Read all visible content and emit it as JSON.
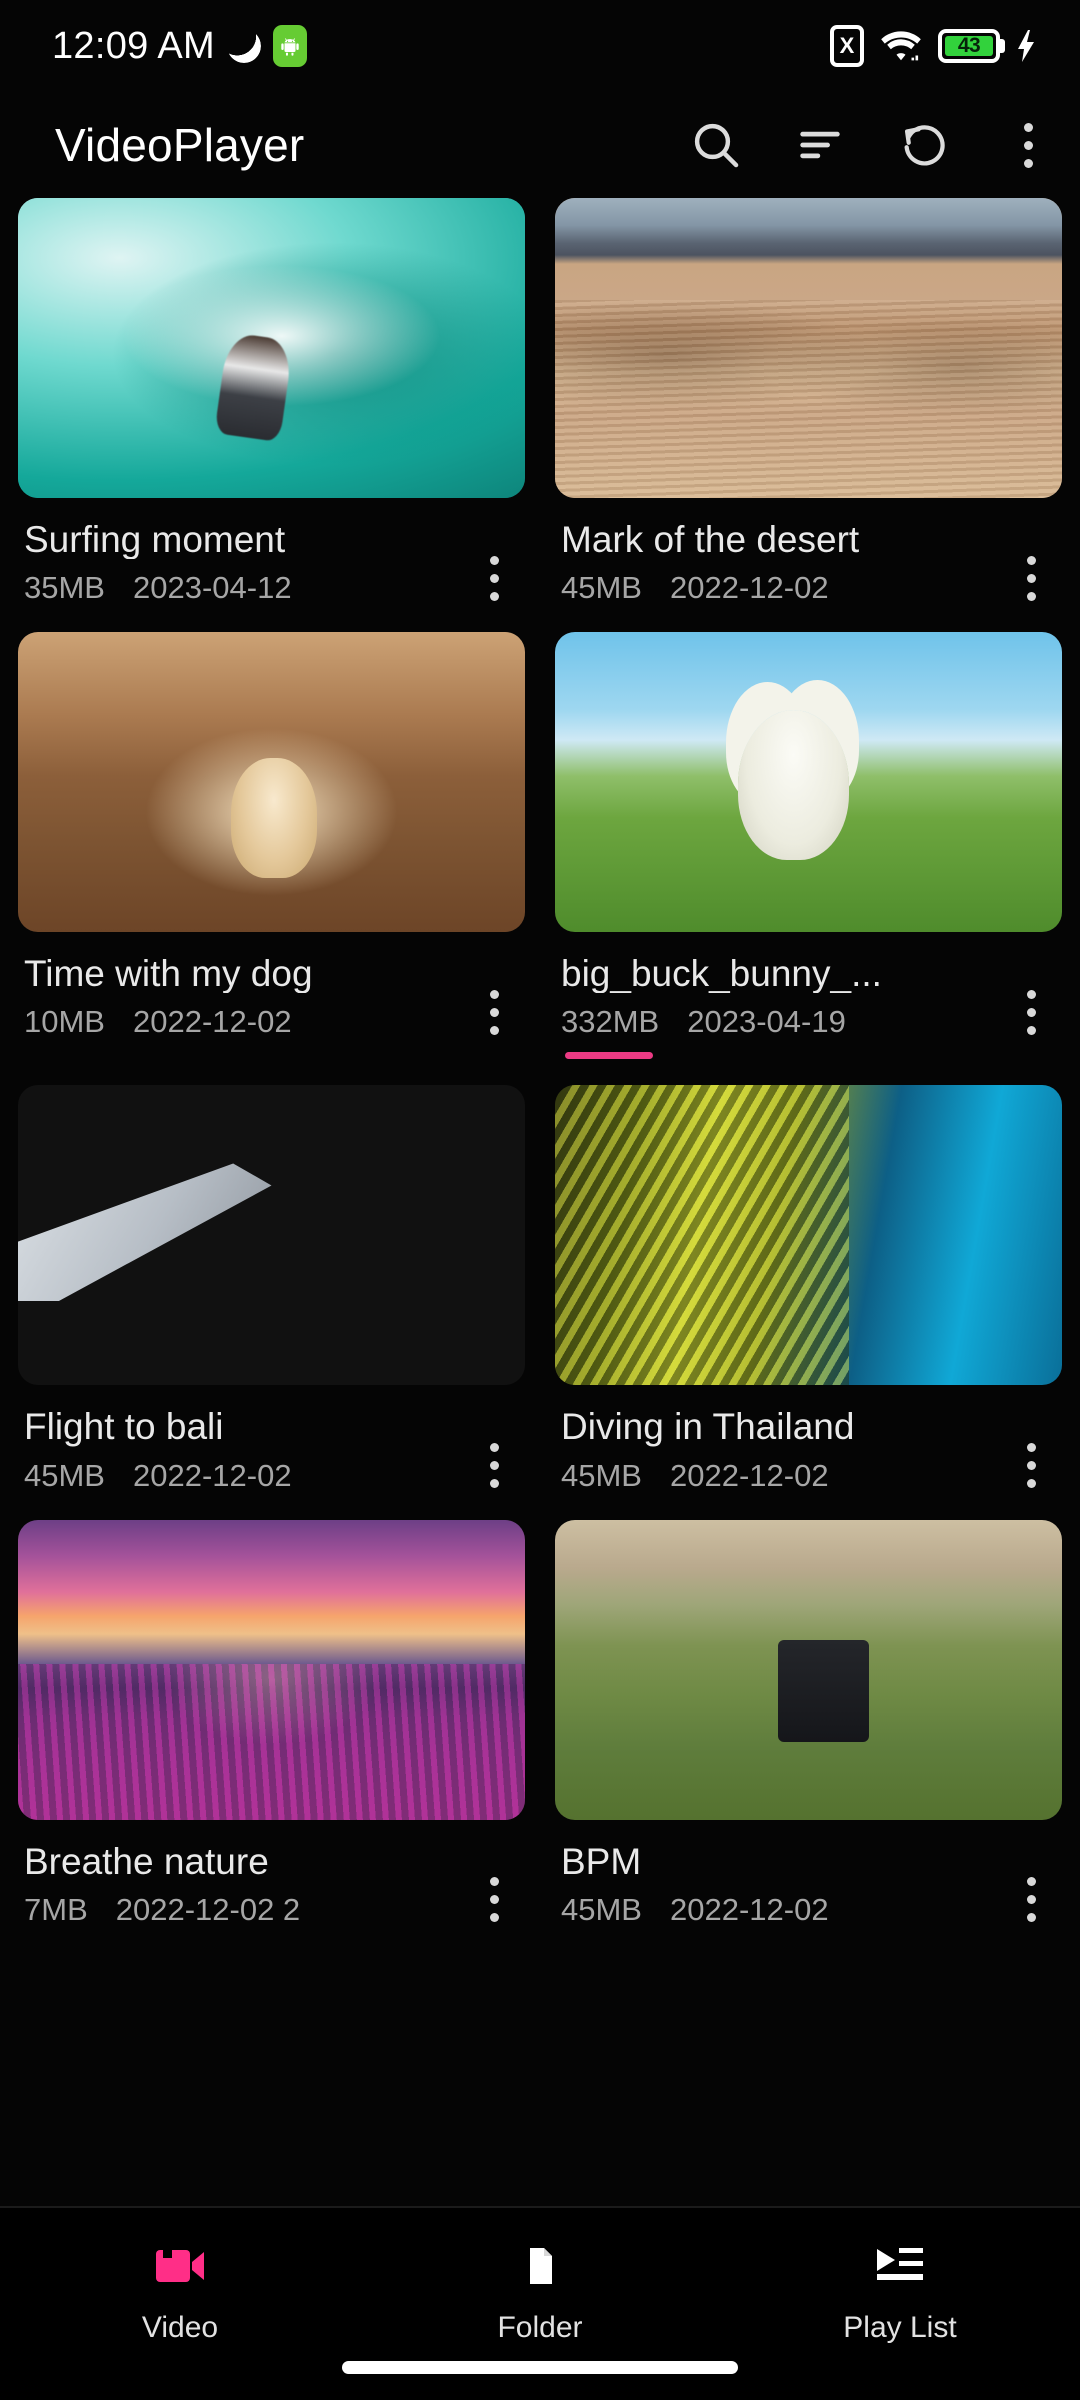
{
  "statusbar": {
    "time": "12:09 AM",
    "moon_icon": "moon-icon",
    "android_icon": "android-robot-icon",
    "sim_icon_label": "X",
    "wifi_icon": "wifi-icon",
    "battery_percent": "43",
    "charging_icon": "lightning-bolt-icon"
  },
  "toolbar": {
    "title": "VideoPlayer",
    "search_icon": "search-icon",
    "sort_icon": "sort-icon",
    "refresh_icon": "refresh-icon",
    "overflow_icon": "more-vertical-icon"
  },
  "videos": [
    {
      "title": "Surfing moment",
      "size": "35MB",
      "date": "2023-04-12",
      "art": "art-surf",
      "progress": false
    },
    {
      "title": "Mark of the desert",
      "size": "45MB",
      "date": "2022-12-02",
      "art": "art-desert",
      "progress": false
    },
    {
      "title": "Time with my dog",
      "size": "10MB",
      "date": "2022-12-02",
      "art": "art-dog",
      "progress": false
    },
    {
      "title": "big_buck_bunny_...",
      "size": "332MB",
      "date": "2023-04-19",
      "art": "art-bunny",
      "progress": true
    },
    {
      "title": "Flight to bali",
      "size": "45MB",
      "date": "2022-12-02",
      "art": "art-flight",
      "progress": false
    },
    {
      "title": "Diving in Thailand",
      "size": "45MB",
      "date": "2022-12-02",
      "art": "art-diving",
      "progress": false
    },
    {
      "title": "Breathe nature",
      "size": "7MB",
      "date": "2022-12-02 2",
      "art": "art-nature",
      "progress": false
    },
    {
      "title": "BPM",
      "size": "45MB",
      "date": "2022-12-02",
      "art": "art-bpm",
      "progress": false
    }
  ],
  "bottom_nav": {
    "items": [
      {
        "label": "Video",
        "icon": "video-camera-icon",
        "active": true
      },
      {
        "label": "Folder",
        "icon": "folder-icon",
        "active": false
      },
      {
        "label": "Play List",
        "icon": "playlist-icon",
        "active": false
      }
    ]
  },
  "colors": {
    "accent_pink": "#FF2E87",
    "progress_pink": "#EC3A84",
    "background": "#050505",
    "battery_green": "#32D23C",
    "android_green": "#66CC33"
  }
}
